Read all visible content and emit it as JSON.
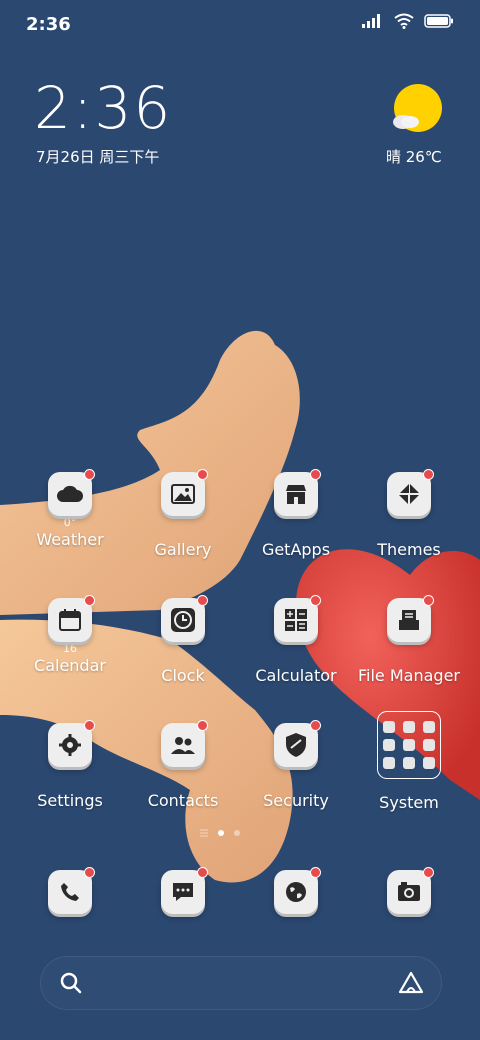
{
  "status_bar": {
    "time": "2:36",
    "icons": [
      "signal-icon",
      "wifi-icon",
      "battery-icon"
    ]
  },
  "widget": {
    "time": "2:36",
    "date": "7月26日 周三下午",
    "weather": "晴 26℃",
    "weather_icon": "sun-cloud-icon"
  },
  "apps": [
    {
      "label": "Weather",
      "icon": "weather-icon",
      "badge": "0°"
    },
    {
      "label": "Gallery",
      "icon": "gallery-icon"
    },
    {
      "label": "GetApps",
      "icon": "store-icon"
    },
    {
      "label": "Themes",
      "icon": "themes-icon"
    },
    {
      "label": "Calendar",
      "icon": "calendar-icon",
      "badge": "16"
    },
    {
      "label": "Clock",
      "icon": "clock-icon"
    },
    {
      "label": "Calculator",
      "icon": "calculator-icon"
    },
    {
      "label": "File Manager",
      "icon": "file-manager-icon"
    },
    {
      "label": "Settings",
      "icon": "settings-icon"
    },
    {
      "label": "Contacts",
      "icon": "contacts-icon"
    },
    {
      "label": "Security",
      "icon": "security-icon"
    },
    {
      "label": "System",
      "icon": "folder-icon"
    }
  ],
  "dock": [
    {
      "icon": "phone-icon"
    },
    {
      "icon": "messages-icon"
    },
    {
      "icon": "browser-icon"
    },
    {
      "icon": "camera-icon"
    }
  ],
  "search": {
    "icon": "search-icon",
    "assistant_icon": "assistant-icon"
  },
  "colors": {
    "background": "#2b4870",
    "badge": "#e84b4b",
    "tile": "#eeeeee"
  }
}
